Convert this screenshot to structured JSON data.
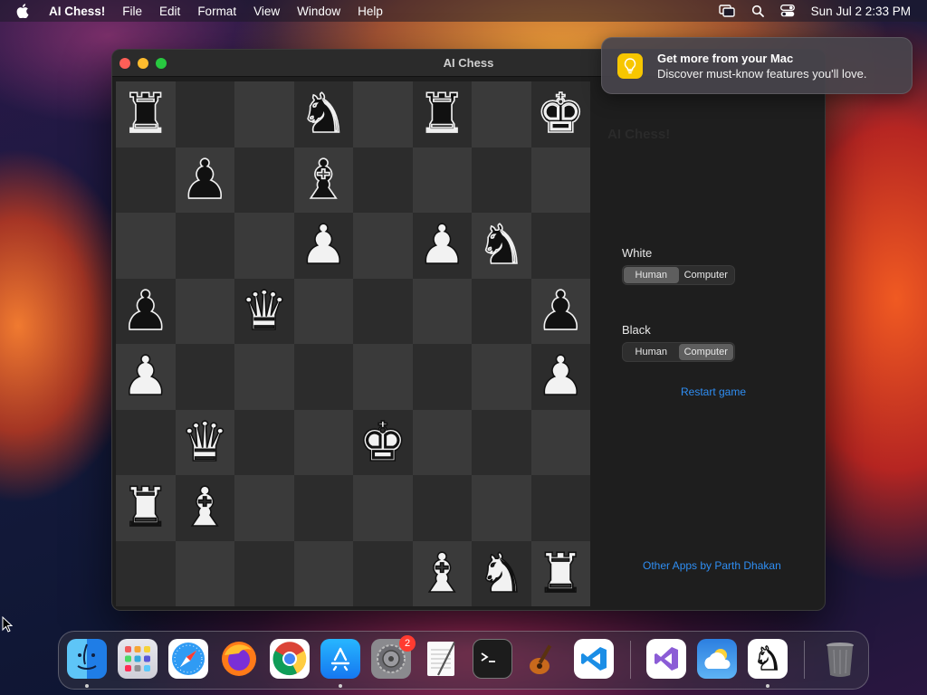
{
  "menubar": {
    "app_name": "AI Chess!",
    "items": [
      "File",
      "Edit",
      "Format",
      "View",
      "Window",
      "Help"
    ],
    "datetime": "Sun Jul 2  2:33 PM"
  },
  "window": {
    "title": "AI Chess"
  },
  "board": {
    "rows": [
      [
        "bR",
        "",
        "",
        "bN",
        "",
        "bR",
        "",
        "bK"
      ],
      [
        "",
        "bP",
        "",
        "bB",
        "",
        "",
        "",
        ""
      ],
      [
        "",
        "",
        "",
        "wP",
        "",
        "wP",
        "bN",
        ""
      ],
      [
        "bP",
        "",
        "wQ",
        "",
        "",
        "",
        "",
        "bP"
      ],
      [
        "wP",
        "",
        "",
        "",
        "",
        "",
        "",
        "wP"
      ],
      [
        "",
        "wQ",
        "",
        "",
        "wK",
        "",
        "",
        ""
      ],
      [
        "wR",
        "wB",
        "",
        "",
        "",
        "",
        "",
        ""
      ],
      [
        "",
        "",
        "",
        "",
        "",
        "wB",
        "wN",
        "wR"
      ]
    ]
  },
  "panel": {
    "app_title": "AI Chess!",
    "blurb": "",
    "white_label": "White",
    "white_options": [
      "Human",
      "Computer"
    ],
    "white_selected": "Human",
    "black_label": "Black",
    "black_options": [
      "Human",
      "Computer"
    ],
    "black_selected": "Computer",
    "restart_label": "Restart game",
    "other_apps_label": "Other Apps by Parth Dhakan"
  },
  "notification": {
    "title": "Get more from your Mac",
    "body": "Discover must-know features you'll love."
  },
  "dock": {
    "settings_badge": "2",
    "apps": [
      "Finder",
      "Launchpad",
      "Safari",
      "Firefox",
      "Chrome",
      "App Store",
      "System Settings",
      "TextEdit",
      "Terminal",
      "GarageBand",
      "Visual Studio Code",
      "Visual Studio",
      "Weather",
      "AI Chess",
      "Trash"
    ]
  }
}
